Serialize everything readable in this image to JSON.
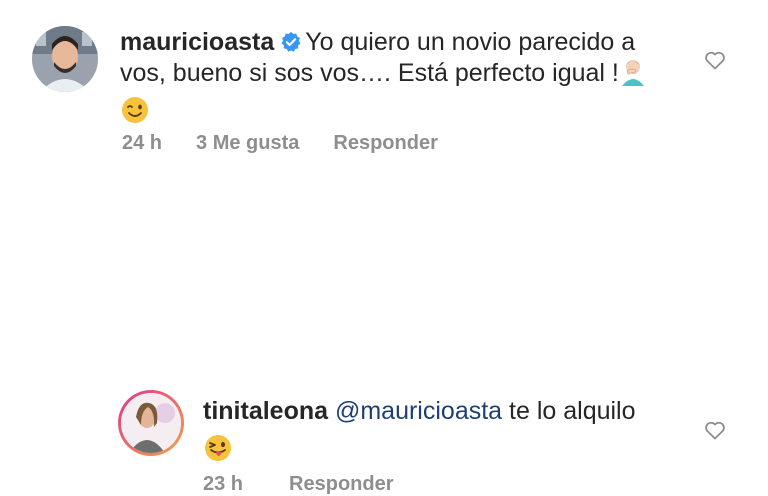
{
  "comments": [
    {
      "username": "mauricioasta",
      "verified": true,
      "text": "Yo quiero un novio parecido a vos, bueno si sos vos…. Está perfecto igual !",
      "emoji_inline": "facepalm-emoji",
      "emoji_end": "wink-emoji",
      "time": "24 h",
      "likes": "3 Me gusta",
      "reply_label": "Responder"
    },
    {
      "username": "tinitaleona",
      "mention": "@mauricioasta",
      "text": "te lo alquilo",
      "emoji_end": "tongue-wink-emoji",
      "time": "23 h",
      "reply_label": "Responder"
    }
  ],
  "colors": {
    "text": "#262626",
    "meta": "#8e8e8e",
    "mention": "#1c3f76",
    "verified": "#3897f0"
  }
}
